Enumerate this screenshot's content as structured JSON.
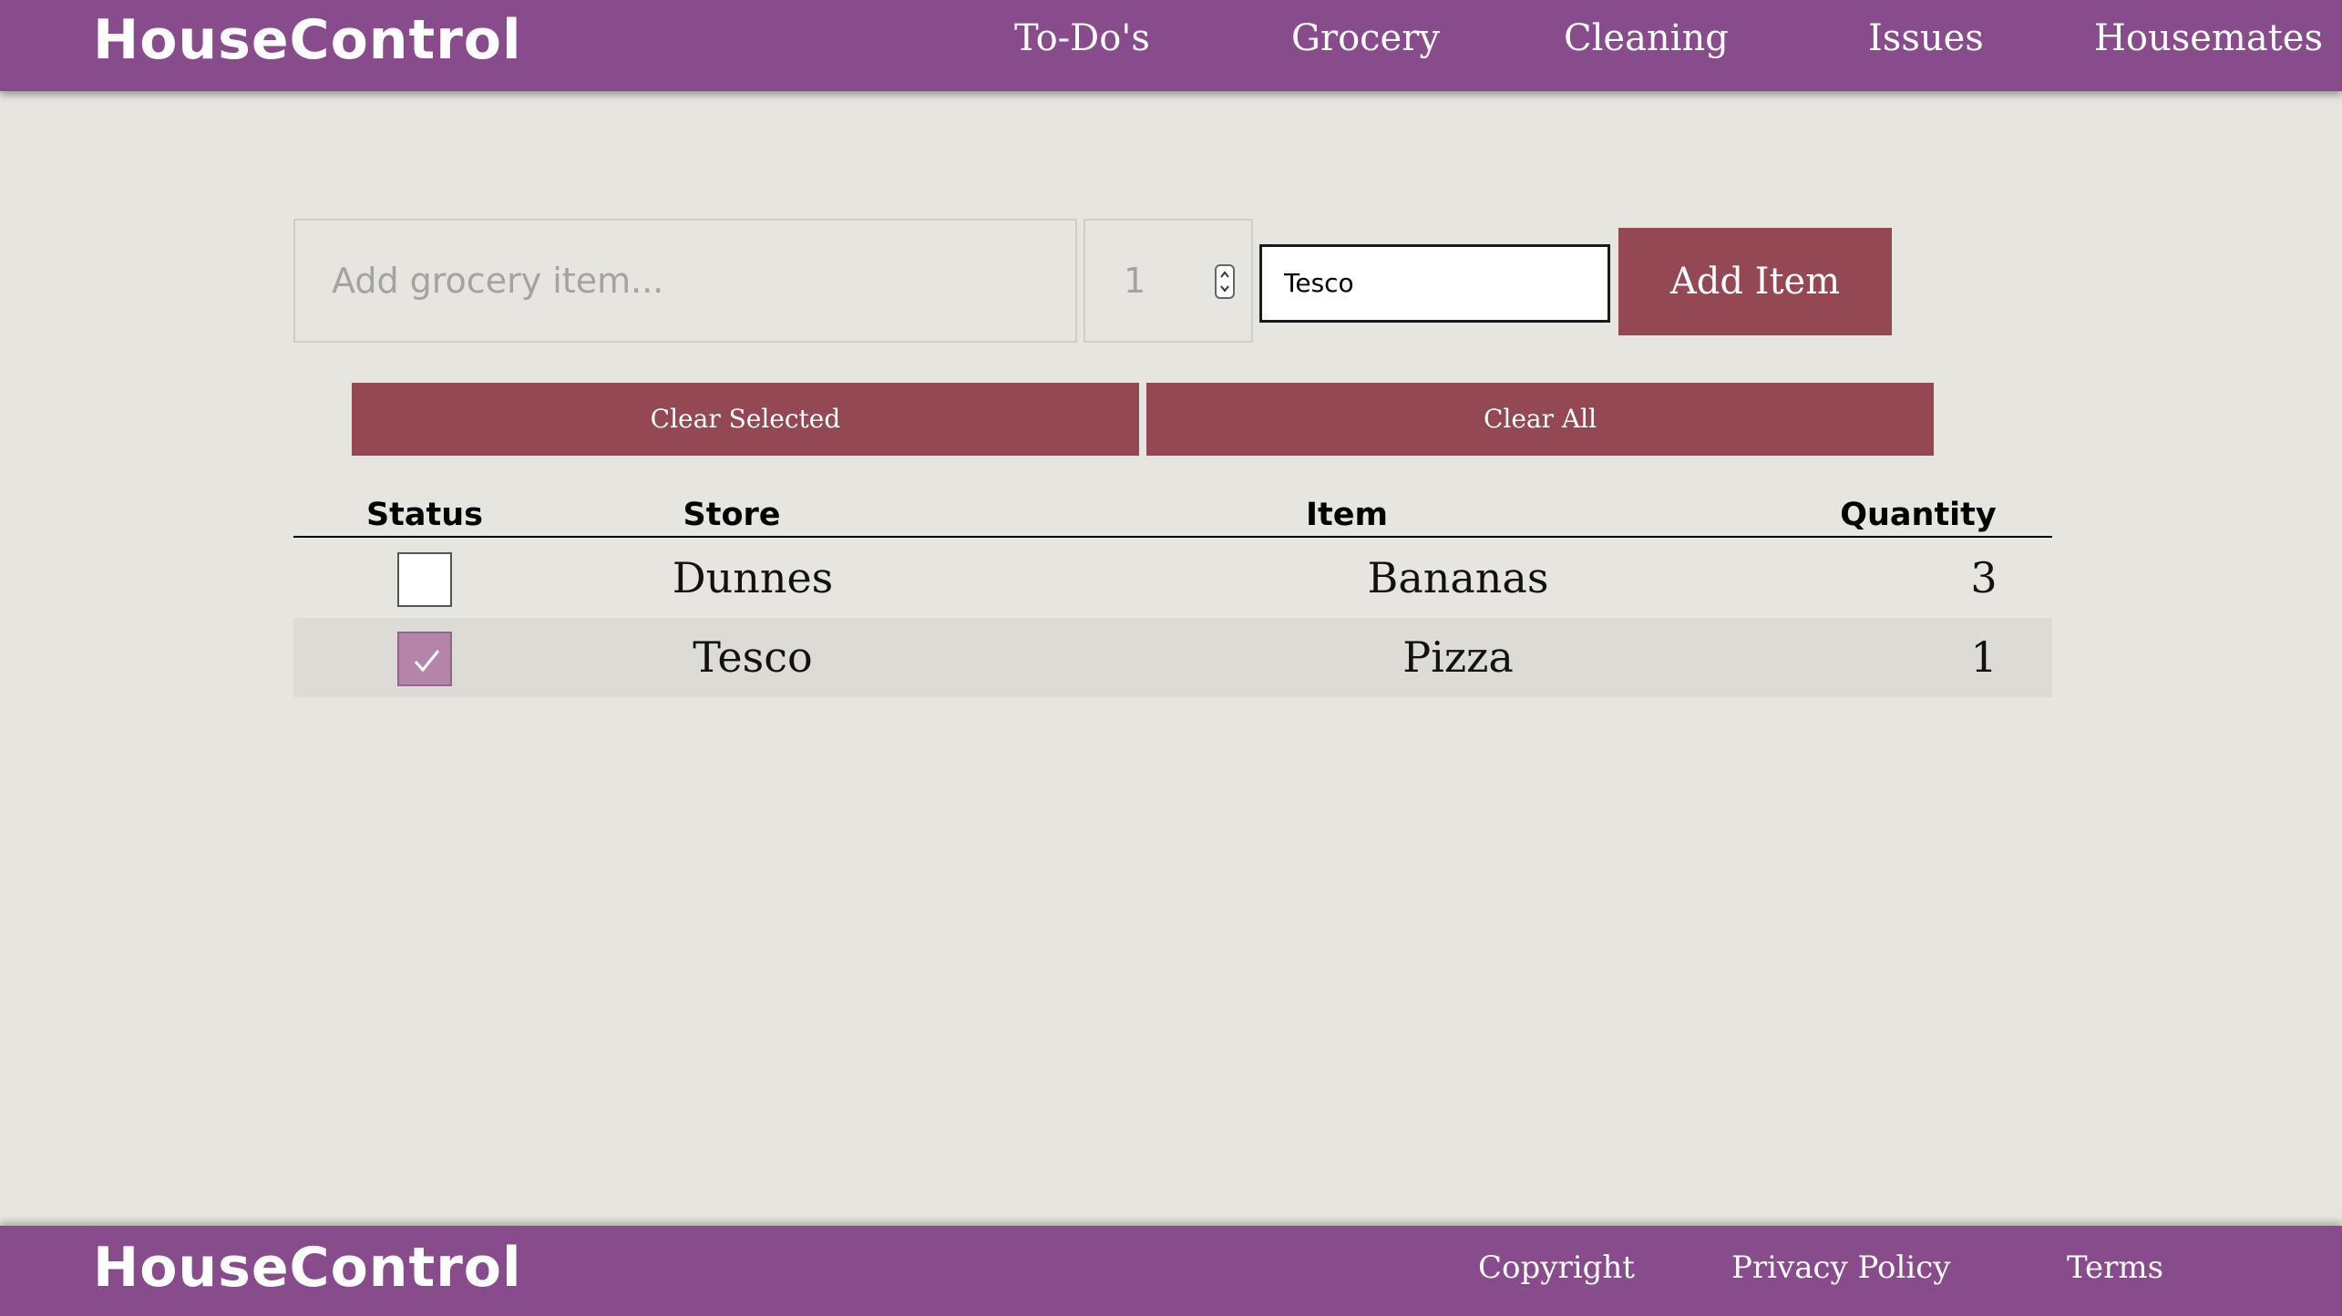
{
  "header": {
    "brand": "HouseControl",
    "nav": [
      "To-Do's",
      "Grocery",
      "Cleaning",
      "Issues",
      "Housemates"
    ]
  },
  "form": {
    "item_placeholder": "Add grocery item...",
    "item_value": "",
    "quantity": "1",
    "store": "Tesco",
    "add_label": "Add Item"
  },
  "actions": {
    "clear_selected": "Clear Selected",
    "clear_all": "Clear All"
  },
  "table": {
    "columns": [
      "Status",
      "Store",
      "Item",
      "Quantity"
    ],
    "rows": [
      {
        "checked": false,
        "store": "Dunnes",
        "item": "Bananas",
        "quantity": "3"
      },
      {
        "checked": true,
        "store": "Tesco",
        "item": "Pizza",
        "quantity": "1"
      }
    ]
  },
  "footer": {
    "brand": "HouseControl",
    "links": [
      "Copyright",
      "Privacy Policy",
      "Terms"
    ]
  },
  "colors": {
    "bar": "#884b8c",
    "button": "#944854",
    "background": "#e6e5e0",
    "checked": "#b484a9"
  }
}
